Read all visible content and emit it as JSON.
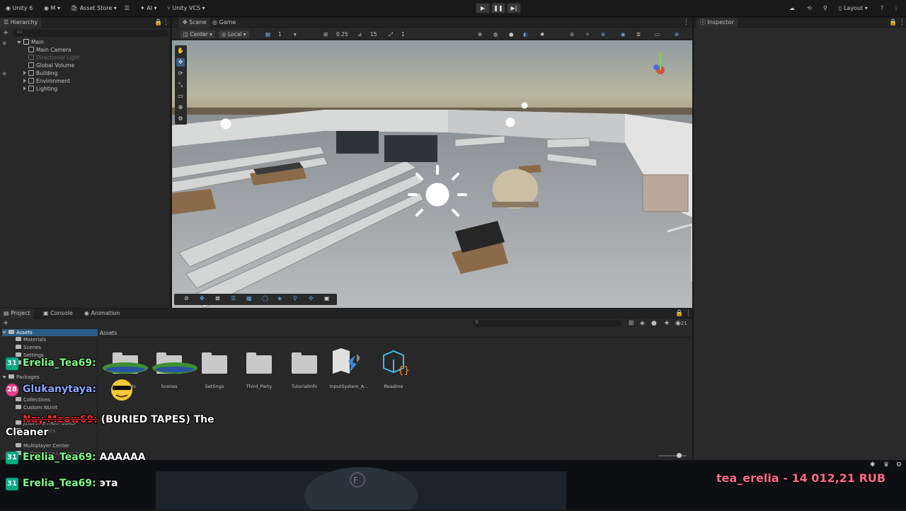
{
  "topbar": {
    "account": "Unity 6",
    "m_menu": "M",
    "asset_store": "Asset Store",
    "ai": "AI",
    "vcs": "Unity VCS",
    "play": "▶",
    "pause": "❚❚",
    "step": "▶|",
    "layout": "Layout"
  },
  "hierarchy": {
    "tab": "Hierarchy",
    "search_placeholder": "All",
    "scene": "Main",
    "items": [
      "Main Camera",
      "Directional Light",
      "Global Volume",
      "Building",
      "Environment",
      "Lighting"
    ]
  },
  "scene_view": {
    "tabs": [
      "Scene",
      "Game"
    ],
    "pivot": "Center",
    "space": "Local",
    "grid_value": "1",
    "snap_value": "0.25",
    "rotate_snap": "15",
    "scale_snap": "1"
  },
  "inspector": {
    "tab": "Inspector"
  },
  "project": {
    "tabs": [
      "Project",
      "Console",
      "Animation"
    ],
    "breadcrumb": "Assets",
    "asset_count": "21",
    "tree_root": "Assets",
    "tree_assets": [
      "Materials",
      "Scenes",
      "Settings",
      "TutorialInfo"
    ],
    "tree_packages_root": "Packages",
    "tree_packages": [
      "Collections",
      "Custom NUnit",
      "JetBrains Rider Editor",
      "Mathematics",
      "Multiplayer Center",
      "Performance testing API"
    ],
    "assets": [
      "Materials",
      "Scenes",
      "Settings",
      "Third_Party",
      "TutorialInfo",
      "InputSystem_A...",
      "Readme"
    ]
  },
  "overlay": {
    "chat": [
      {
        "badge": "31",
        "user": "Erelia_Tea69:",
        "message": "",
        "color": "#7dff8a"
      },
      {
        "badge": "28",
        "user": "Glukanytaya:",
        "message": "",
        "color": "#8aa6ff"
      },
      {
        "badge": "",
        "user": "Nay Meow69:",
        "message": "(BURIED TAPES) The",
        "color": "#ff2a2a"
      },
      {
        "badge": "",
        "user": "",
        "message": "Cleaner",
        "color": "#ffffff"
      },
      {
        "badge": "31",
        "user": "Erelia_Tea69:",
        "message": "AAAAAA",
        "color": "#7dff8a"
      },
      {
        "badge": "31",
        "user": "Erelia_Tea69:",
        "message": "эта",
        "color": "#7dff8a"
      }
    ],
    "donation": "tea_erelia - 14 012,21 RUB"
  },
  "colors": {
    "accent": "#3a79bb",
    "chat_green": "#7dff8a",
    "chat_blue": "#8aa6ff",
    "donation_pink": "#ff6b8a"
  }
}
